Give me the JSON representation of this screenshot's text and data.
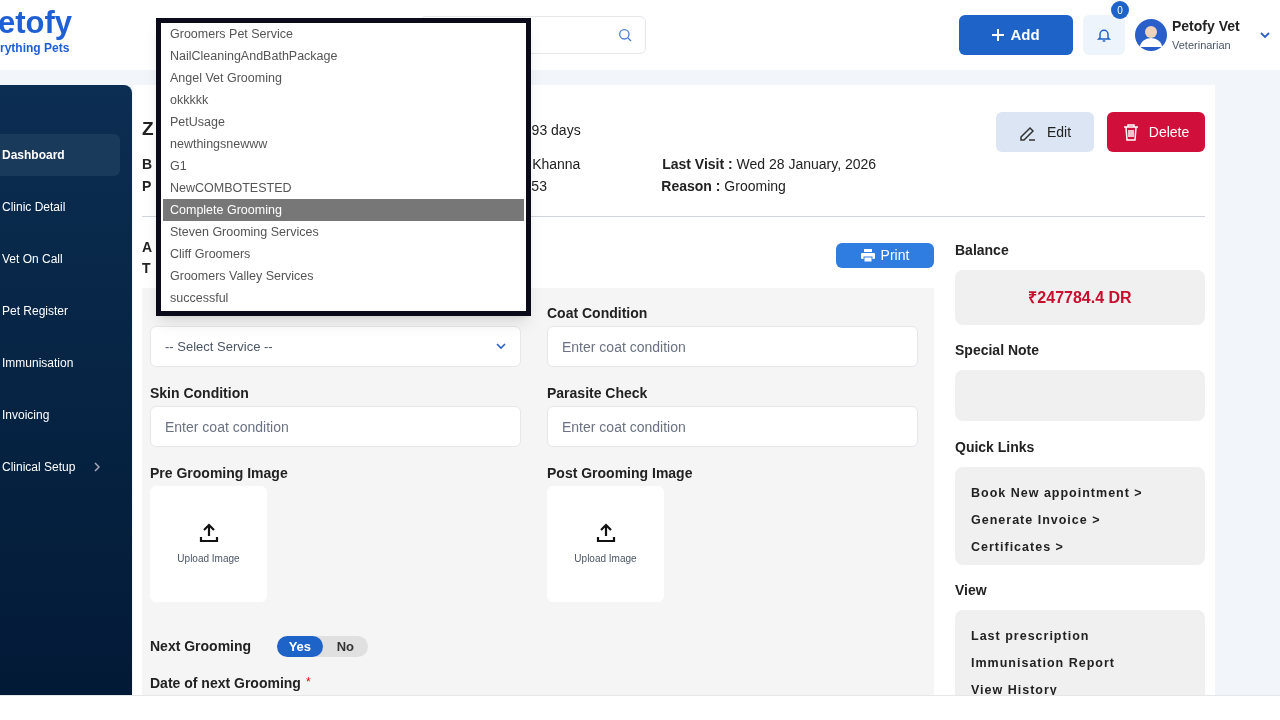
{
  "header": {
    "logo": {
      "name": "etofy",
      "tagline": "rything Pets"
    },
    "add_button": "Add",
    "notifications": {
      "count": "0"
    },
    "user": {
      "name": "Petofy Vet",
      "role": "Veterinarian"
    }
  },
  "sidebar": {
    "items": [
      {
        "label": "Dashboard",
        "selected": true,
        "expandable": false
      },
      {
        "label": "Clinic Detail",
        "selected": false,
        "expandable": false
      },
      {
        "label": "Vet On Call",
        "selected": false,
        "expandable": false
      },
      {
        "label": "Pet Register",
        "selected": false,
        "expandable": false
      },
      {
        "label": "Immunisation",
        "selected": false,
        "expandable": false
      },
      {
        "label": "Invoicing",
        "selected": false,
        "expandable": false
      },
      {
        "label": "Clinical Setup",
        "selected": false,
        "expandable": true
      }
    ]
  },
  "pet": {
    "name": "Z",
    "age": "93 days",
    "rows": [
      {
        "key": "B",
        "value": "Khanna",
        "label": "Last Visit :",
        "text": "Wed 28 January, 2026"
      },
      {
        "key": "P",
        "value": "53",
        "label": "Reason :",
        "text": "Grooming"
      }
    ]
  },
  "actions": [
    {
      "kind": "edit",
      "label": "Edit"
    },
    {
      "kind": "delete",
      "label": "Delete"
    }
  ],
  "section": {
    "lines": [
      "A",
      "T"
    ],
    "print_button": "Print"
  },
  "form": {
    "service_select": {
      "placeholder": "-- Select Service --"
    },
    "fields": [
      {
        "kind": "input",
        "label": "Coat Condition",
        "placeholder": "Enter coat condition"
      },
      {
        "kind": "input",
        "label": "Skin Condition",
        "placeholder": "Enter coat condition"
      },
      {
        "kind": "input",
        "label": "Parasite Check",
        "placeholder": "Enter coat condition"
      },
      {
        "kind": "upload",
        "label": "Pre Grooming Image",
        "caption": "Upload Image"
      },
      {
        "kind": "upload",
        "label": "Post Grooming Image",
        "caption": "Upload Image"
      }
    ],
    "next_grooming": {
      "label": "Next Grooming",
      "options": [
        {
          "label": "Yes",
          "selected": true
        },
        {
          "label": "No",
          "selected": false
        }
      ]
    },
    "date_field": {
      "label": "Date of next Grooming",
      "required_mark": "*"
    }
  },
  "side_panel": {
    "balance": {
      "label": "Balance",
      "amount": "₹247784.4 DR"
    },
    "special_note": {
      "label": "Special Note"
    },
    "quick_links": {
      "label": "Quick Links",
      "links": [
        "Book New appointment >",
        "Generate Invoice >",
        "Certificates >"
      ]
    },
    "view": {
      "label": "View",
      "links": [
        "Last prescription",
        "Immunisation Report",
        "View History"
      ]
    }
  },
  "dropdown": {
    "items": [
      {
        "label": "Groomers Pet Service",
        "selected": false
      },
      {
        "label": "NailCleaningAndBathPackage",
        "selected": false
      },
      {
        "label": "Angel Vet Grooming",
        "selected": false
      },
      {
        "label": "okkkkk",
        "selected": false
      },
      {
        "label": "PetUsage",
        "selected": false
      },
      {
        "label": "newthingsnewww",
        "selected": false
      },
      {
        "label": "G1",
        "selected": false
      },
      {
        "label": "NewCOMBOTESTED",
        "selected": false
      },
      {
        "label": "Complete Grooming",
        "selected": true
      },
      {
        "label": "Steven Grooming Services",
        "selected": false
      },
      {
        "label": "Cliff Groomers",
        "selected": false
      },
      {
        "label": "Groomers Valley Services",
        "selected": false
      },
      {
        "label": "successful",
        "selected": false
      }
    ]
  }
}
